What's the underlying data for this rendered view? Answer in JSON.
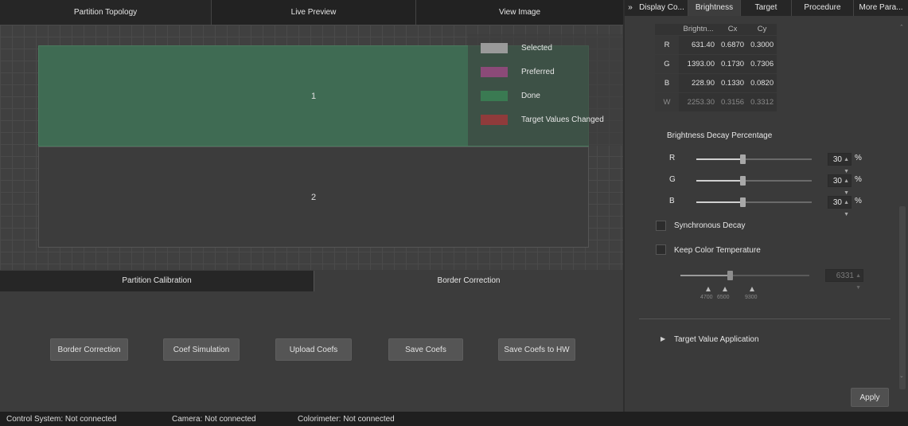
{
  "main_tabs": [
    "Partition Topology",
    "Live Preview",
    "View Image"
  ],
  "partitions": [
    "1",
    "2"
  ],
  "legend": [
    {
      "label": "Selected",
      "color": "#9a9a9a"
    },
    {
      "label": "Preferred",
      "color": "#8b4a78"
    },
    {
      "label": "Done",
      "color": "#3a7a52"
    },
    {
      "label": "Target Values Changed",
      "color": "#8f3b3b"
    }
  ],
  "bottom_tabs": [
    "Partition Calibration",
    "Border Correction"
  ],
  "buttons": [
    "Border Correction",
    "Coef Simulation",
    "Upload Coefs",
    "Save Coefs",
    "Save Coefs to HW"
  ],
  "right_tabs": {
    "arrow": "»",
    "items": [
      "Display Co...",
      "Brightness",
      "Target",
      "Procedure",
      "More Para..."
    ]
  },
  "table": {
    "headers": [
      "",
      "Brightn...",
      "Cx",
      "Cy"
    ],
    "rows": [
      {
        "label": "R",
        "brightness": "631.40",
        "cx": "0.6870",
        "cy": "0.3000"
      },
      {
        "label": "G",
        "brightness": "1393.00",
        "cx": "0.1730",
        "cy": "0.7306"
      },
      {
        "label": "B",
        "brightness": "228.90",
        "cx": "0.1330",
        "cy": "0.0820"
      },
      {
        "label": "W",
        "brightness": "2253.30",
        "cx": "0.3156",
        "cy": "0.3312"
      }
    ]
  },
  "decay": {
    "title": "Brightness Decay Percentage",
    "unit": "%",
    "channels": [
      {
        "label": "R",
        "value": "30",
        "level": 0.4
      },
      {
        "label": "G",
        "value": "30",
        "level": 0.4
      },
      {
        "label": "B",
        "value": "30",
        "level": 0.4
      }
    ]
  },
  "sync_decay": {
    "label": "Synchronous Decay",
    "checked": false
  },
  "keep_temp": {
    "label": "Keep Color Temperature",
    "checked": false
  },
  "temp_slider": {
    "value": "6331",
    "level": 0.38,
    "ticks": [
      "4700",
      "6500",
      "9300"
    ]
  },
  "target_value_application": {
    "arrow": "▶",
    "label": "Target Value Application"
  },
  "apply_label": "Apply",
  "status": {
    "control": "Control System:  Not connected",
    "camera": "Camera:  Not connected",
    "colorimeter": "Colorimeter:  Not connected"
  }
}
